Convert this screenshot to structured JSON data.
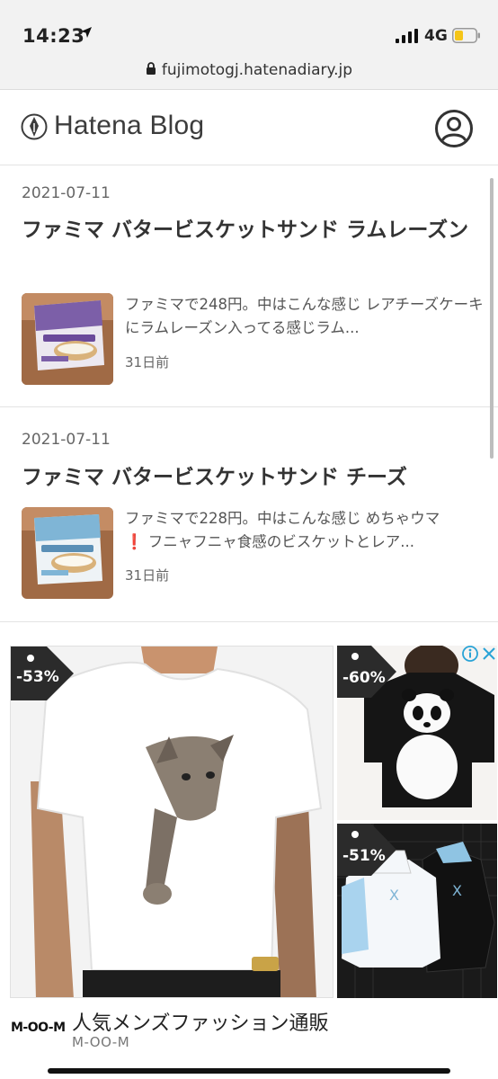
{
  "status_bar": {
    "time": "14:23",
    "network": "4G",
    "url": "fujimotogj.hatenadiary.jp"
  },
  "header": {
    "logo_text": "Hatena Blog"
  },
  "articles": [
    {
      "date": "2021-07-11",
      "title": "ファミマ バタービスケットサンド ラムレーズン",
      "excerpt": "ファミマで248円。中はこんな感じ レアチーズケーキにラムレーズン入ってる感じラム...",
      "ago": "31日前"
    },
    {
      "date": "2021-07-11",
      "title": "ファミマ バタービスケットサンド チーズ",
      "excerpt_line1": "ファミマで228円。中はこんな感じ めちゃウマ",
      "excerpt_line2": "❗ フニャフニャ食感のビスケットとレア...",
      "ago": "31日前"
    }
  ],
  "ad": {
    "discounts": [
      "-53%",
      "-60%",
      "-51%"
    ],
    "brand_logo": "M-OO-M",
    "title": "人気メンズファッション通販",
    "advertiser": "M-OO-M"
  },
  "colors": {
    "accent": "#333333",
    "badge_bg": "#2b2b2b"
  }
}
